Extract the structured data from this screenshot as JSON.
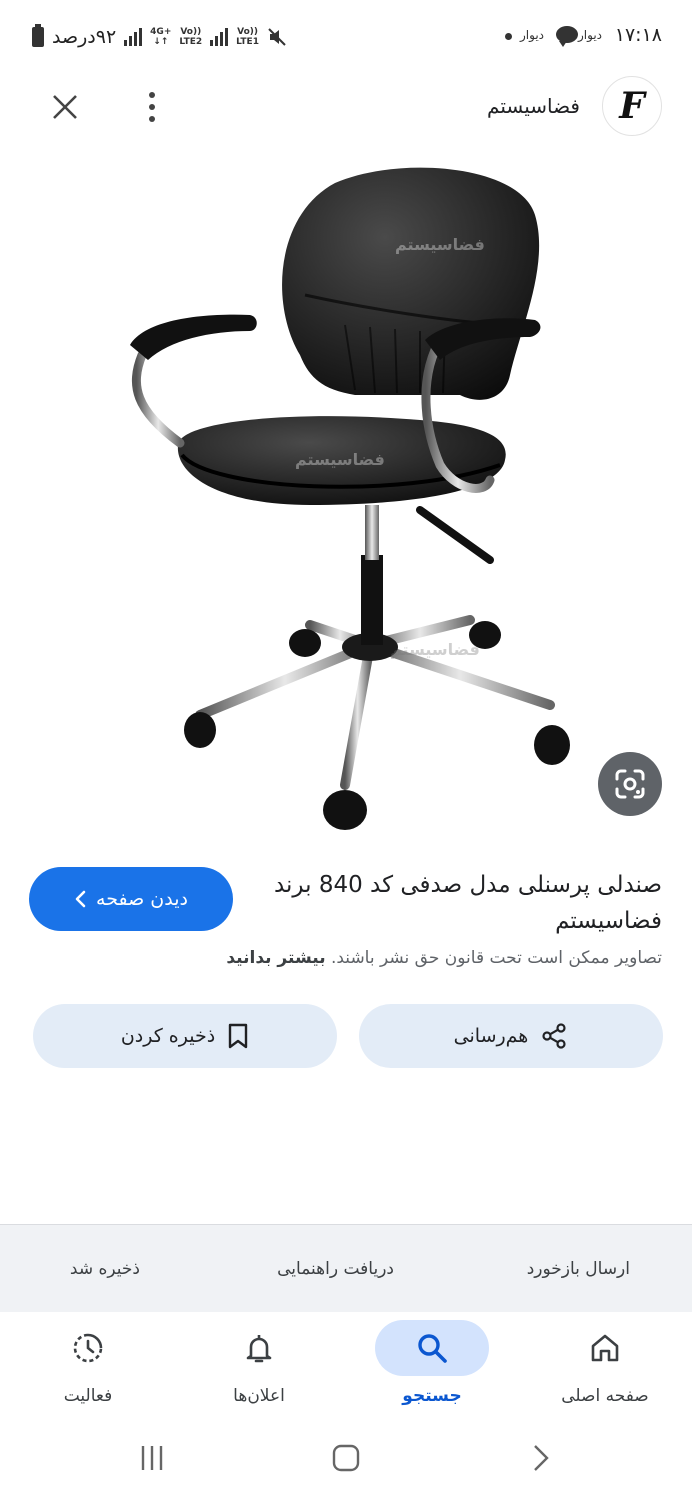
{
  "status_bar": {
    "time": "۱۷:۱۸",
    "notification_app_1": "دیوار",
    "notification_app_2": "دیوار",
    "battery_text": "۹۲درصد",
    "network_1": "4G+",
    "network_2_top": "Vo))",
    "network_2_bottom": "LTE2",
    "network_3_top": "Vo))",
    "network_3_bottom": "LTE1"
  },
  "header": {
    "site_name": "فضاسیستم",
    "logo_letter": "F",
    "close_icon": "close-icon",
    "more_icon": "more-vert-icon"
  },
  "image": {
    "watermark": "فضاسیستم",
    "lens_icon": "google-lens-icon"
  },
  "result": {
    "title": "صندلی پرسنلی مدل صدفی کد 840 برند فضاسیستم",
    "visit_label": "دیدن صفحه",
    "copyright_text": "تصاویر ممکن است تحت قانون حق نشر باشند.",
    "copyright_link": "بیشتر بدانید"
  },
  "actions": {
    "share_label": "هم‌رسانی",
    "save_label": "ذخیره کردن"
  },
  "feedback": {
    "send_feedback": "ارسال بازخورد",
    "get_help": "دریافت راهنمایی",
    "saved": "ذخیره شد"
  },
  "bottom_nav": {
    "items": [
      {
        "label": "صفحه اصلی",
        "icon": "home-icon"
      },
      {
        "label": "جستجو",
        "icon": "search-icon",
        "active": true
      },
      {
        "label": "اعلان‌ها",
        "icon": "bell-icon"
      },
      {
        "label": "فعالیت",
        "icon": "activity-icon"
      }
    ]
  },
  "colors": {
    "accent": "#1a73e8",
    "active_nav_bg": "#d3e3fd",
    "action_button_bg": "#e3ecf7"
  }
}
